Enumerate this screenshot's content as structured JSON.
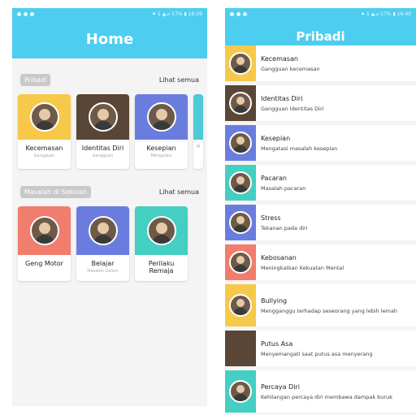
{
  "left": {
    "status": {
      "left_icons": "",
      "right_text": "⚫ 1 ▲⊿ 57% ▮ 16:39"
    },
    "title": "Home",
    "section1": {
      "chip": "Pribadi",
      "see_all": "Lihat semua",
      "cards": [
        {
          "title": "Kecemasan",
          "sub": "Gangguan",
          "color": "#f7c94a"
        },
        {
          "title": "Identitas Diri",
          "sub": "Gangguan",
          "color": "#5a4636"
        },
        {
          "title": "Kesepian",
          "sub": "Mengatasi",
          "color": "#6a7ddf"
        },
        {
          "title": "",
          "sub": "M",
          "color": "#4ec9d8"
        }
      ]
    },
    "section2": {
      "chip": "Masalah di Sekolah",
      "see_all": "Lihat semua",
      "cards": [
        {
          "title": "Geng Motor",
          "sub": "",
          "color": "#f07d6e"
        },
        {
          "title": "Belajar",
          "sub": "Masalah Dalam",
          "color": "#6a7ddf"
        },
        {
          "title": "Perilaku Remaja",
          "sub": "",
          "color": "#45cfc2"
        }
      ]
    }
  },
  "right": {
    "status": {
      "right_text": "⚫ 1 ▲⊿ 57% ▮ 16:40"
    },
    "title": "Pribadi",
    "items": [
      {
        "title": "Kecemasan",
        "sub": "Gangguan kecemasan",
        "color": "#f7c94a"
      },
      {
        "title": "Identitas Diri",
        "sub": "Gangguan Identitas Diri",
        "color": "#5a4636"
      },
      {
        "title": "Kesepian",
        "sub": "Mengatasi masalah kesepian",
        "color": "#6a7ddf"
      },
      {
        "title": "Pacaran",
        "sub": "Masalah pacaran",
        "color": "#45cfc2"
      },
      {
        "title": "Stress",
        "sub": "Tekanan pada diri",
        "color": "#6a7ddf"
      },
      {
        "title": "Kebosanan",
        "sub": "Meningkatkan Kekuatan Mental",
        "color": "#f07d6e"
      },
      {
        "title": "Bullying",
        "sub": "Mengganggu terhadap seseorang yang lebih lemah",
        "color": "#f7c94a"
      },
      {
        "title": "Putus Asa",
        "sub": "Menyemangati saat putus asa menyerang",
        "color": "#5a4636"
      },
      {
        "title": "Percaya Diri",
        "sub": "Kehilangan percaya diri membawa dampak buruk",
        "color": "#45cfc2"
      }
    ]
  }
}
